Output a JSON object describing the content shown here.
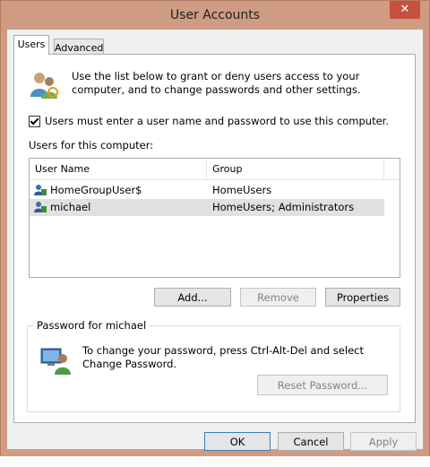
{
  "window": {
    "title": "User Accounts",
    "close_glyph": "✕"
  },
  "tabs": [
    {
      "label": "Users",
      "active": true
    },
    {
      "label": "Advanced",
      "active": false
    }
  ],
  "intro": {
    "icon": "users-icon",
    "text": "Use the list below to grant or deny users access to your computer, and to change passwords and other settings."
  },
  "require_password": {
    "label": "Users must enter a user name and password to use this computer.",
    "checked": true
  },
  "users_section": {
    "label": "Users for this computer:"
  },
  "user_list": {
    "columns": [
      "User Name",
      "Group"
    ],
    "rows": [
      {
        "name": "HomeGroupUser$",
        "group": "HomeUsers",
        "selected": false
      },
      {
        "name": "michael",
        "group": "HomeUsers; Administrators",
        "selected": true
      }
    ]
  },
  "list_buttons": {
    "add": "Add...",
    "remove": "Remove",
    "properties": "Properties"
  },
  "password_box": {
    "title": "Password for michael",
    "text": "To change your password, press Ctrl-Alt-Del and select Change Password.",
    "reset_button": "Reset Password..."
  },
  "dialog_buttons": {
    "ok": "OK",
    "cancel": "Cancel",
    "apply": "Apply"
  },
  "colors": {
    "frame": "#cf9c83",
    "close": "#c7503f",
    "ok_border": "#3c7fb1"
  }
}
